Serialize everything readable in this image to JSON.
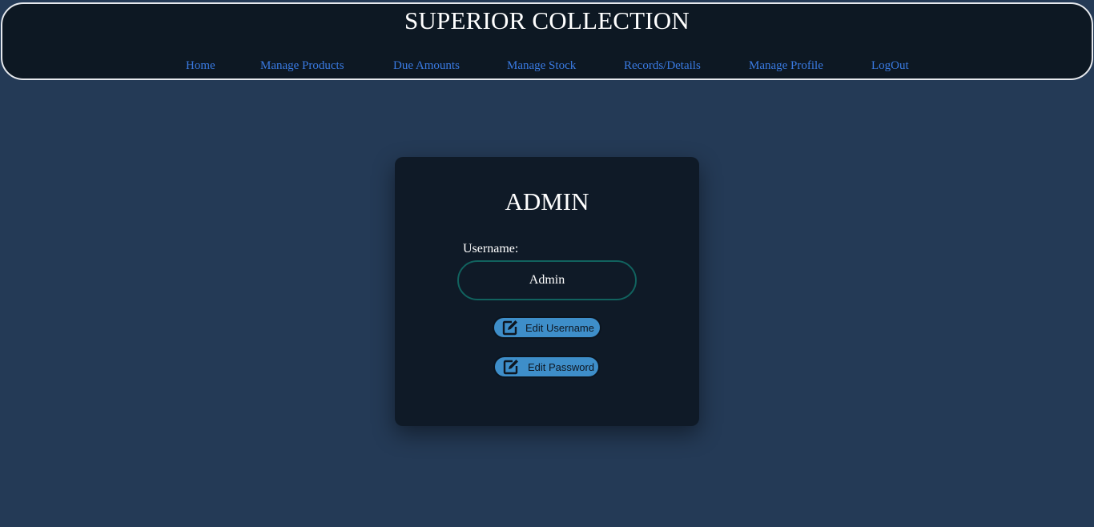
{
  "header": {
    "title": "SUPERIOR COLLECTION",
    "nav": [
      {
        "label": "Home"
      },
      {
        "label": "Manage Products"
      },
      {
        "label": "Due Amounts"
      },
      {
        "label": "Manage Stock"
      },
      {
        "label": "Records/Details"
      },
      {
        "label": "Manage Profile"
      },
      {
        "label": "LogOut"
      }
    ]
  },
  "profile_card": {
    "title": "ADMIN",
    "username_label": "Username:",
    "username_value": "Admin",
    "edit_username_label": "Edit Username",
    "edit_password_label": "Edit Password",
    "edit_icon": "edit-icon"
  },
  "colors": {
    "background": "#243a56",
    "header_bg": "#0d1823",
    "nav_link": "#3a7be3",
    "card_bg": "#0f1a27",
    "input_border": "#11625e",
    "button_bg": "#3e8ec9"
  }
}
